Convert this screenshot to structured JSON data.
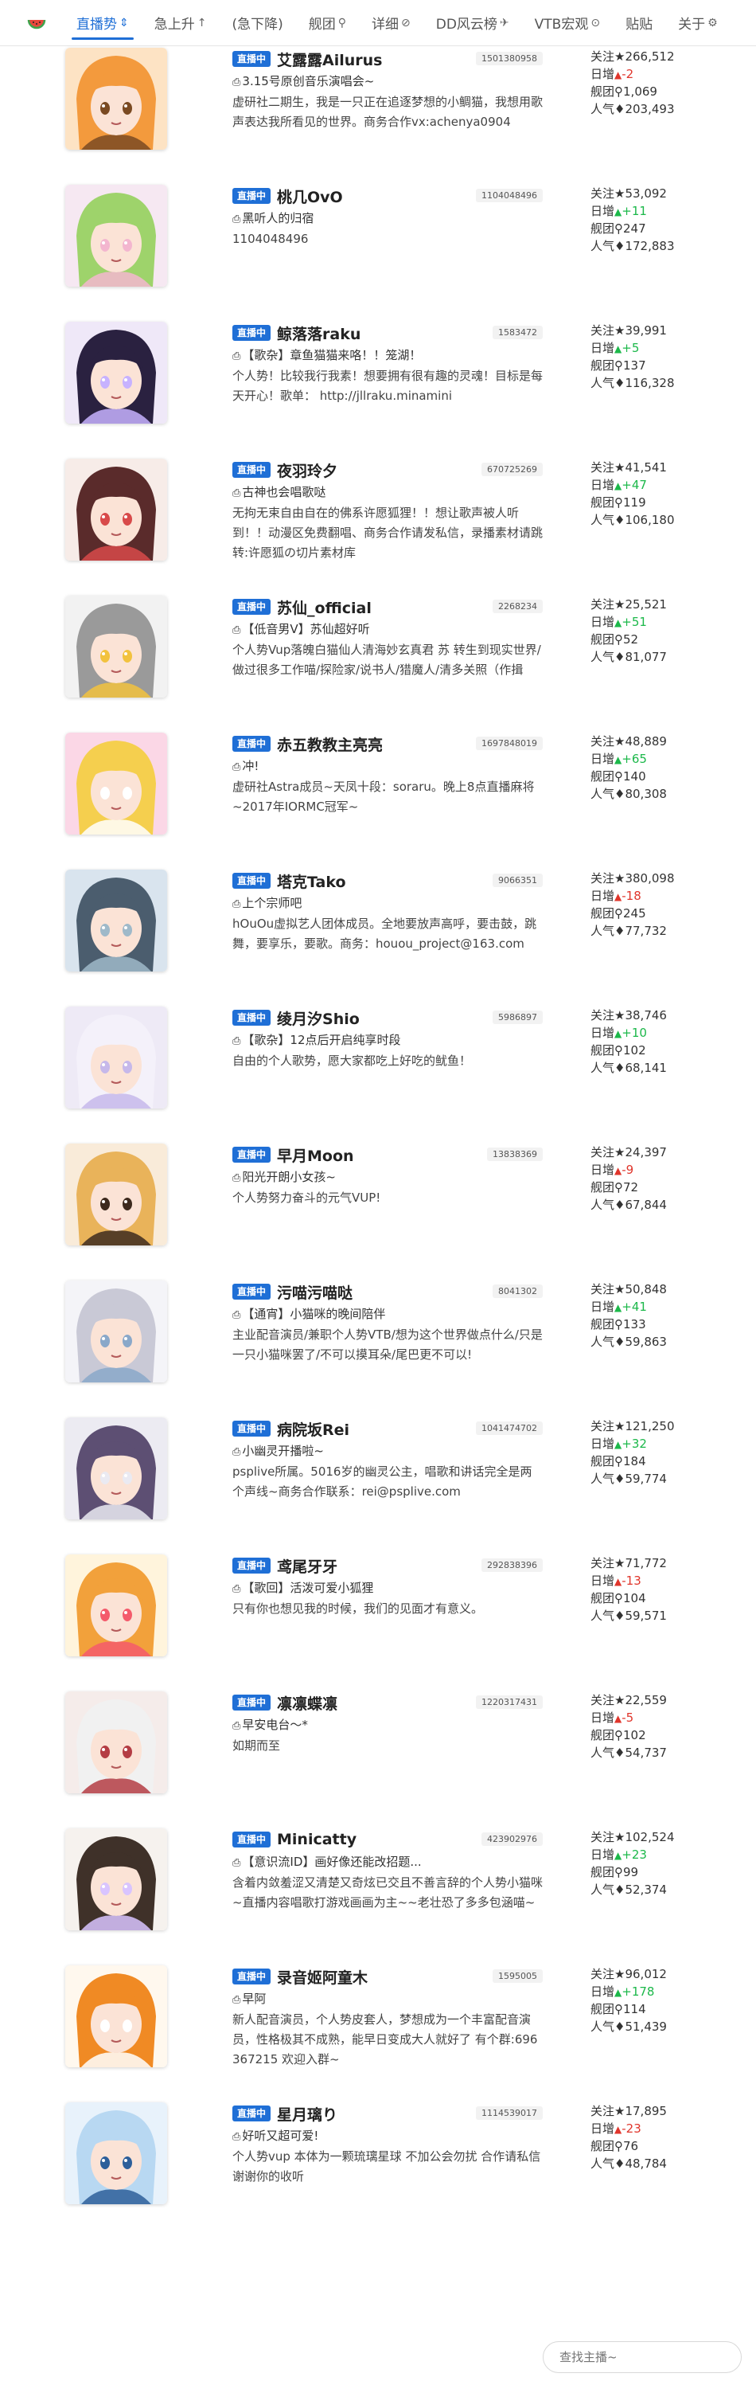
{
  "nav": {
    "items": [
      {
        "label": "直播势",
        "glyph": "⇕",
        "active": true
      },
      {
        "label": "急上升",
        "glyph": "↑"
      },
      {
        "label": "(急下降)",
        "glyph": ""
      },
      {
        "label": "舰团",
        "glyph": "⚲"
      },
      {
        "label": "详细",
        "glyph": "⊘"
      },
      {
        "label": "DD风云榜",
        "glyph": "✈"
      },
      {
        "label": "VTB宏观",
        "glyph": "⊙"
      },
      {
        "label": "贴贴",
        "glyph": ""
      },
      {
        "label": "关于",
        "glyph": "⚙"
      }
    ]
  },
  "labels": {
    "live": "直播中",
    "follow": "关注",
    "daily": "日增",
    "guard": "舰团",
    "popularity": "人气",
    "follow_icon": "★",
    "guard_icon": "⚲",
    "pop_icon": "♦"
  },
  "colors": {
    "accent": "#1f6fd6",
    "up": "#1cb84a",
    "down": "#e0352b"
  },
  "vtubers": [
    {
      "name": "艾露露Ailurus",
      "roomid": "1501380958",
      "title": "3.15号原创音乐演唱会~",
      "sign": "虚研社二期生，我是一只正在追逐梦想的小鲷猫，我想用歌声表达我所看见的世界。商务合作vx:achenya0904",
      "follow": "266,512",
      "daily": "-2",
      "dir": "down",
      "guard": "1,069",
      "pop": "203,493"
    },
    {
      "name": "桃几OvO",
      "roomid": "1104048496",
      "title": "黑听人的归宿",
      "sign": "1104048496",
      "follow": "53,092",
      "daily": "+11",
      "dir": "up",
      "guard": "247",
      "pop": "172,883"
    },
    {
      "name": "鲸落落raku",
      "roomid": "1583472",
      "title": "【歌杂】章鱼猫猫来咯！！笼湖！",
      "sign": "个人势！比较我行我素！想要拥有很有趣的灵魂！目标是每天开心！歌单： http://jllraku.minamini",
      "follow": "39,991",
      "daily": "+5",
      "dir": "up",
      "guard": "137",
      "pop": "116,328"
    },
    {
      "name": "夜羽玲夕",
      "roomid": "670725269",
      "title": "古神也会唱歌哒",
      "sign": "无拘无束自由自在的佛系许愿狐狸！！想让歌声被人听到！！动漫区免费翻唱、商务合作请发私信，录播素材请跳转:许愿狐の切片素材库",
      "follow": "41,541",
      "daily": "+47",
      "dir": "up",
      "guard": "119",
      "pop": "106,180"
    },
    {
      "name": "苏仙_official",
      "roomid": "2268234",
      "title": "【低音男V】苏仙超好听",
      "sign": "个人势Vup落魄白猫仙人清海妙玄真君 苏 转生到现实世界/做过很多工作喵/探险家/说书人/猎魔人/清多关照（作揖",
      "follow": "25,521",
      "daily": "+51",
      "dir": "up",
      "guard": "52",
      "pop": "81,077"
    },
    {
      "name": "赤五教教主亮亮",
      "roomid": "1697848019",
      "title": "冲!",
      "sign": "虚研社Astra成员~天凤十段：soraru。晚上8点直播麻将~2017年IORMC冠军~",
      "follow": "48,889",
      "daily": "+65",
      "dir": "up",
      "guard": "140",
      "pop": "80,308"
    },
    {
      "name": "塔克Tako",
      "roomid": "9066351",
      "title": "上个宗师吧",
      "sign": "hOuOu虚拟艺人团体成员。全地要放声高呼，要击鼓，跳舞，要享乐，要歌。商务：houou_project@163.com",
      "follow": "380,098",
      "daily": "-18",
      "dir": "down",
      "guard": "245",
      "pop": "77,732"
    },
    {
      "name": "绫月汐Shio",
      "roomid": "5986897",
      "title": "【歌杂】12点后开启纯享时段",
      "sign": "自由的个人歌势，愿大家都吃上好吃的鱿鱼！",
      "follow": "38,746",
      "daily": "+10",
      "dir": "up",
      "guard": "102",
      "pop": "68,141"
    },
    {
      "name": "早月Moon",
      "roomid": "13838369",
      "title": "阳光开朗小女孩~",
      "sign": "个人势努力奋斗的元气VUP!",
      "follow": "24,397",
      "daily": "-9",
      "dir": "down",
      "guard": "72",
      "pop": "67,844"
    },
    {
      "name": "污喵污喵哒",
      "roomid": "8041302",
      "title": "【通宵】小猫咪的晚间陪伴",
      "sign": "主业配音演员/兼职个人势VTB/想为这个世界做点什么/只是一只小猫咪罢了/不可以摸耳朵/尾巴更不可以!",
      "follow": "50,848",
      "daily": "+41",
      "dir": "up",
      "guard": "133",
      "pop": "59,863"
    },
    {
      "name": "病院坂Rei",
      "roomid": "1041474702",
      "title": "小幽灵开播啦~",
      "sign": "psplive所属。5016岁的幽灵公主，唱歌和讲话完全是两个声线~商务合作联系：rei@psplive.com",
      "follow": "121,250",
      "daily": "+32",
      "dir": "up",
      "guard": "184",
      "pop": "59,774"
    },
    {
      "name": "鸢尾牙牙",
      "roomid": "292838396",
      "title": "【歌回】活泼可爱小狐狸",
      "sign": "只有你也想见我的时候，我们的见面才有意义。",
      "follow": "71,772",
      "daily": "-13",
      "dir": "down",
      "guard": "104",
      "pop": "59,571"
    },
    {
      "name": "凛凛蝶凛",
      "roomid": "1220317431",
      "title": "早安电台～*",
      "sign": "如期而至",
      "follow": "22,559",
      "daily": "-5",
      "dir": "down",
      "guard": "102",
      "pop": "54,737"
    },
    {
      "name": "Minicatty",
      "roomid": "423902976",
      "title": "【意识流ID】画好像还能改招题...",
      "sign": "含着内敛羞涩又清楚又奇炫已交且不善言辞的个人势小猫咪~直播内容唱歌打游戏画画为主~~老壮恐了多多包涵喵~",
      "follow": "102,524",
      "daily": "+23",
      "dir": "up",
      "guard": "99",
      "pop": "52,374"
    },
    {
      "name": "录音姬阿童木",
      "roomid": "1595005",
      "title": "早阿",
      "sign": "新人配音演员，个人势皮套人，梦想成为一个丰富配音演员，性格极其不成熟，能早日变成大人就好了 有个群:696367215 欢迎入群~",
      "follow": "96,012",
      "daily": "+178",
      "dir": "up",
      "guard": "114",
      "pop": "51,439"
    },
    {
      "name": "星月璃り",
      "roomid": "1114539017",
      "title": "好听又超可爱!",
      "sign": "个人势vup 本体为一颗琉璃星球 不加公会勿扰 合作请私信 谢谢你的收听",
      "follow": "17,895",
      "daily": "-23",
      "dir": "down",
      "guard": "76",
      "pop": "48,784"
    }
  ],
  "search": {
    "placeholder": "查找主播~"
  }
}
